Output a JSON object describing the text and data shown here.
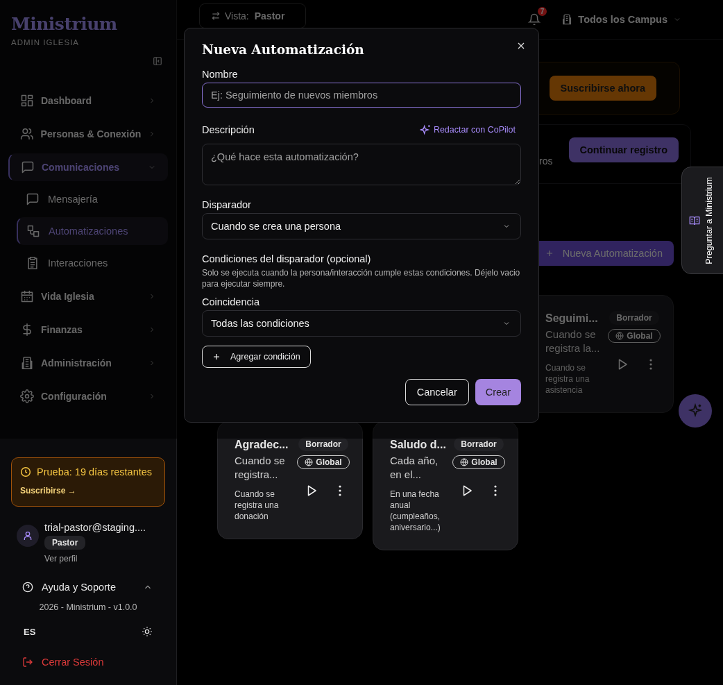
{
  "brand": {
    "name": "Ministrium",
    "subtitle": "ADMIN IGLESIA"
  },
  "sidebar": {
    "items": [
      {
        "label": "Dashboard",
        "selected": false,
        "expanded": false
      },
      {
        "label": "Personas & Conexión",
        "selected": false,
        "expanded": false
      },
      {
        "label": "Comunicaciones",
        "selected": true,
        "expanded": true,
        "children": [
          {
            "label": "Mensajería",
            "selected": false
          },
          {
            "label": "Automatizaciones",
            "selected": true
          },
          {
            "label": "Interacciones",
            "selected": false
          }
        ]
      },
      {
        "label": "Vida Iglesia",
        "selected": false,
        "expanded": false
      },
      {
        "label": "Finanzas",
        "selected": false,
        "expanded": false
      },
      {
        "label": "Administración",
        "selected": false,
        "expanded": false
      },
      {
        "label": "Configuración",
        "selected": false,
        "expanded": false
      }
    ]
  },
  "trial": {
    "text": "Prueba: 19 días restantes",
    "link": "Suscribirse →"
  },
  "user": {
    "email": "trial-pastor@staging....",
    "role": "Pastor",
    "profile_link": "Ver perfil"
  },
  "help": {
    "label": "Ayuda y Soporte",
    "expanded": true,
    "version": "2026 - Ministrium - v1.0.0"
  },
  "language": "ES",
  "logout": "Cerrar Sesión",
  "topbar": {
    "view_label": "Vista:",
    "view_value": "Pastor",
    "notifications": "7",
    "campus": "Todos los Campus"
  },
  "banners": [
    {
      "kind": "trial",
      "button": "Suscribirse ahora"
    },
    {
      "kind": "onboarding",
      "text": "ros",
      "button": "Continuar registro"
    }
  ],
  "new_button": "Nueva Automatización",
  "automations": [
    {
      "title": "Seguimi...",
      "description": "Cuando se registra la...",
      "trigger": "Cuando se registra una asistencia",
      "status": "Borrador",
      "scope": "Global"
    },
    {
      "title": "Agradec...",
      "description": "Cuando se registra...",
      "trigger": "Cuando se registra una donación",
      "status": "Borrador",
      "scope": "Global"
    },
    {
      "title": "Saludo d...",
      "description": "Cada año, en el...",
      "trigger": "En una fecha anual (cumpleaños, aniversario...)",
      "status": "Borrador",
      "scope": "Global"
    }
  ],
  "assistant_tab": "Preguntar a Ministrium",
  "modal": {
    "title": "Nueva Automatización",
    "name": {
      "label": "Nombre",
      "placeholder": "Ej: Seguimiento de nuevos miembros",
      "focused": true
    },
    "description": {
      "label": "Descripción",
      "copilot": "Redactar con CoPilot",
      "placeholder": "¿Qué hace esta automatización?"
    },
    "trigger": {
      "label": "Disparador",
      "value": "Cuando se crea una persona"
    },
    "conditions": {
      "title": "Condiciones del disparador (opcional)",
      "help": "Solo se ejecuta cuando la persona/interacción cumple estas condiciones. Déjelo vacio para ejecutar siempre."
    },
    "match": {
      "label": "Coincidencia",
      "value": "Todas las condiciones"
    },
    "add_condition": "Agregar condición",
    "cancel": "Cancelar",
    "create": "Crear"
  }
}
